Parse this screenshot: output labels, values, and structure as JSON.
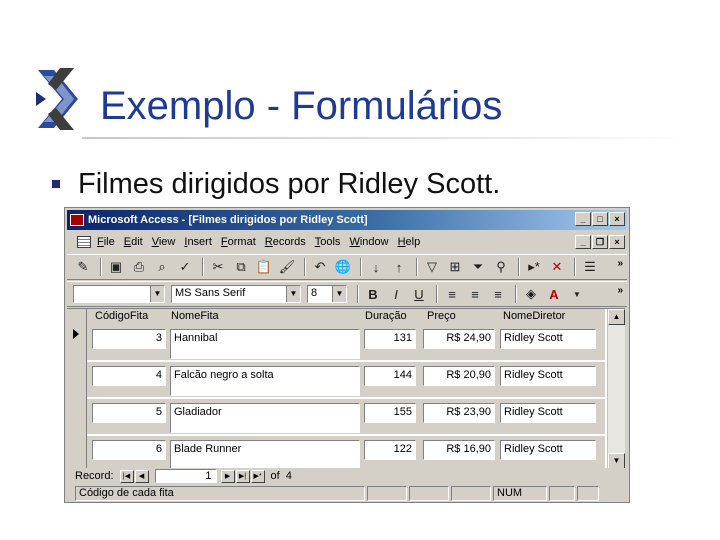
{
  "slide": {
    "title": "Exemplo - Formulários",
    "bullet": "Filmes dirigidos por Ridley Scott."
  },
  "window": {
    "title": "Microsoft Access - [Filmes dirigidos por Ridley Scott]",
    "menu": [
      "File",
      "Edit",
      "View",
      "Insert",
      "Format",
      "Records",
      "Tools",
      "Window",
      "Help"
    ],
    "font_name": "MS Sans Serif",
    "font_size": "8",
    "format_buttons": [
      "B",
      "I",
      "U"
    ]
  },
  "form": {
    "headers": [
      "CódigoFita",
      "NomeFita",
      "Duração",
      "Preço",
      "NomeDiretor"
    ],
    "rows": [
      {
        "codigo": "3",
        "nome": "Hannibal",
        "duracao": "131",
        "preco": "R$ 24,90",
        "diretor": "Ridley Scott"
      },
      {
        "codigo": "4",
        "nome": "Falcão negro a solta",
        "duracao": "144",
        "preco": "R$ 20,90",
        "diretor": "Ridley Scott"
      },
      {
        "codigo": "5",
        "nome": "Gladiador",
        "duracao": "155",
        "preco": "R$ 23,90",
        "diretor": "Ridley Scott"
      },
      {
        "codigo": "6",
        "nome": "Blade Runner",
        "duracao": "122",
        "preco": "R$ 16,90",
        "diretor": "Ridley Scott"
      }
    ]
  },
  "nav": {
    "label": "Record:",
    "current": "1",
    "of_label": "of",
    "total": "4"
  },
  "status": {
    "text": "Código de cada fita",
    "num": "NUM"
  }
}
